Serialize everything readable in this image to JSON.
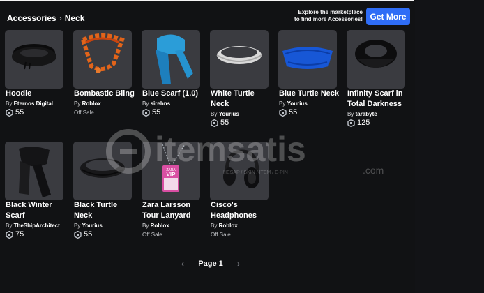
{
  "breadcrumb": {
    "category": "Accessories",
    "subcategory": "Neck"
  },
  "promo": {
    "text_line1": "Explore the marketplace",
    "text_line2": "to find more Accessories!",
    "button_label": "Get More",
    "button_color": "#2f6df6"
  },
  "items": [
    {
      "name_line1": "Hoodie",
      "name_line2": "",
      "creator": "Eternos Digital",
      "price": "55",
      "status": ""
    },
    {
      "name_line1": "Bombastic Bling",
      "name_line2": "",
      "creator": "Roblox",
      "price": "",
      "status": "Off Sale"
    },
    {
      "name_line1": "Blue Scarf (1.0)",
      "name_line2": "",
      "creator": "sirehns",
      "price": "55",
      "status": ""
    },
    {
      "name_line1": "White Turtle",
      "name_line2": "Neck",
      "creator": "Yourius",
      "price": "55",
      "status": ""
    },
    {
      "name_line1": "Blue Turtle Neck",
      "name_line2": "",
      "creator": "Yourius",
      "price": "55",
      "status": ""
    },
    {
      "name_line1": "Infinity Scarf in",
      "name_line2": "Total Darkness",
      "creator": "tarabyte",
      "price": "125",
      "status": ""
    },
    {
      "name_line1": "Black Winter",
      "name_line2": "Scarf",
      "creator": "TheShipArchitect",
      "price": "75",
      "status": ""
    },
    {
      "name_line1": "Black Turtle",
      "name_line2": "Neck",
      "creator": "Yourius",
      "price": "55",
      "status": ""
    },
    {
      "name_line1": "Zara Larsson",
      "name_line2": "Tour Lanyard",
      "creator": "Roblox",
      "price": "",
      "status": "Off Sale"
    },
    {
      "name_line1": "Cisco's",
      "name_line2": "Headphones",
      "creator": "Roblox",
      "price": "",
      "status": "Off Sale"
    }
  ],
  "by_label": "By",
  "pagination": {
    "label": "Page 1"
  },
  "watermark": {
    "brand": "itemsatis",
    "tagline": "HESAP / SKIN / ITEM / E-PIN",
    "suffix": ".com"
  },
  "lanyard_badge": {
    "line1": "ZARA",
    "line2": "VIP"
  },
  "colors": {
    "background": "#111214",
    "thumb": "#3a3b40",
    "accent": "#2f6df6",
    "robux": "#bfc3ca"
  },
  "icons": [
    "chevron-right-icon",
    "robux-icon",
    "chevron-left-icon",
    "chevron-right-icon"
  ]
}
